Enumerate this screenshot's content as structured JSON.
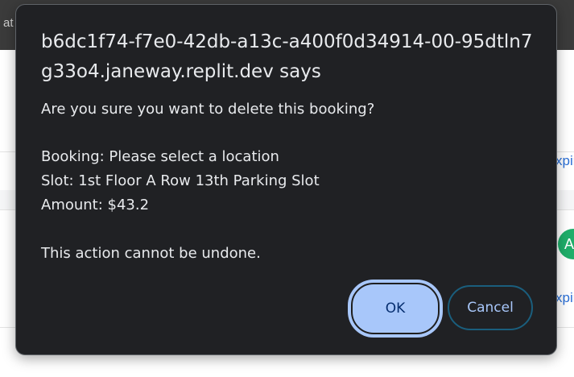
{
  "background": {
    "topbar_fragment": "at",
    "link_fragment_1": "xpir",
    "link_fragment_2": "xpir",
    "avatar_letter": "A"
  },
  "dialog": {
    "title": "b6dc1f74-f7e0-42db-a13c-a400f0d34914-00-95dtln7g33o4.janeway.replit.dev says",
    "message_lines": [
      "Are you sure you want to delete this booking?",
      "Booking: Please select a location",
      "Slot: 1st Floor A Row 13th Parking Slot",
      "Amount: $43.2",
      "This action cannot be undone."
    ],
    "ok_label": "OK",
    "cancel_label": "Cancel"
  },
  "colors": {
    "dialog_bg": "#202124",
    "ok_bg": "#a8c7fa",
    "cancel_text": "#a8c7fa",
    "avatar_bg": "#1fae6a",
    "link": "#2b6fd6"
  }
}
